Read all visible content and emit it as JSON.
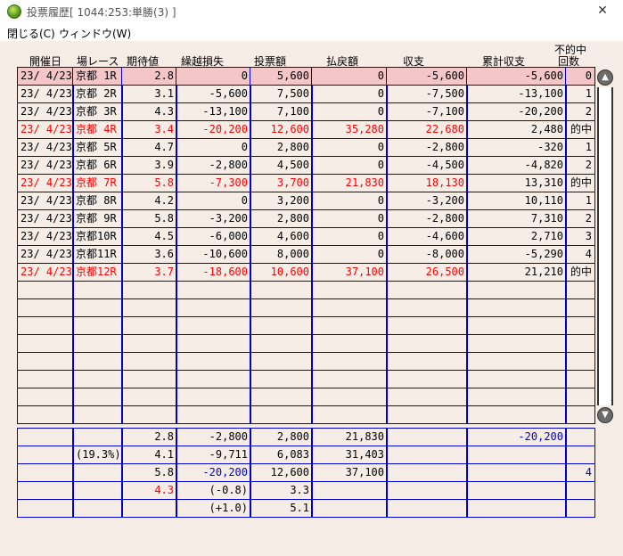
{
  "window": {
    "title": "投票履歴[ 1044:253:単勝(3) ]",
    "close_glyph": "✕"
  },
  "menu": {
    "close": "閉じる(C)",
    "window": "ウィンドウ(W)"
  },
  "headers": {
    "date": "開催日",
    "race": "場レース",
    "expected": "期待値",
    "carryover": "繰越損失",
    "bet": "投票額",
    "payout": "払戻額",
    "balance": "収支",
    "cumulative": "累計収支",
    "miss_line1": "不的中",
    "miss_line2": "回数"
  },
  "rows": [
    {
      "date": "23/ 4/23",
      "race": "京都 1R",
      "exp": "2.8",
      "carry": "0",
      "bet": "5,600",
      "pay": "0",
      "bal": "-5,600",
      "cum": "-5,600",
      "miss": "0",
      "style": "hl"
    },
    {
      "date": "23/ 4/23",
      "race": "京都 2R",
      "exp": "3.1",
      "carry": "-5,600",
      "bet": "7,500",
      "pay": "0",
      "bal": "-7,500",
      "cum": "-13,100",
      "miss": "1",
      "style": ""
    },
    {
      "date": "23/ 4/23",
      "race": "京都 3R",
      "exp": "4.3",
      "carry": "-13,100",
      "bet": "7,100",
      "pay": "0",
      "bal": "-7,100",
      "cum": "-20,200",
      "miss": "2",
      "style": ""
    },
    {
      "date": "23/ 4/23",
      "race": "京都 4R",
      "exp": "3.4",
      "carry": "-20,200",
      "bet": "12,600",
      "pay": "35,280",
      "bal": "22,680",
      "cum": "2,480",
      "miss": "的中",
      "style": "hit"
    },
    {
      "date": "23/ 4/23",
      "race": "京都 5R",
      "exp": "4.7",
      "carry": "0",
      "bet": "2,800",
      "pay": "0",
      "bal": "-2,800",
      "cum": "-320",
      "miss": "1",
      "style": ""
    },
    {
      "date": "23/ 4/23",
      "race": "京都 6R",
      "exp": "3.9",
      "carry": "-2,800",
      "bet": "4,500",
      "pay": "0",
      "bal": "-4,500",
      "cum": "-4,820",
      "miss": "2",
      "style": ""
    },
    {
      "date": "23/ 4/23",
      "race": "京都 7R",
      "exp": "5.8",
      "carry": "-7,300",
      "bet": "3,700",
      "pay": "21,830",
      "bal": "18,130",
      "cum": "13,310",
      "miss": "的中",
      "style": "hit"
    },
    {
      "date": "23/ 4/23",
      "race": "京都 8R",
      "exp": "4.2",
      "carry": "0",
      "bet": "3,200",
      "pay": "0",
      "bal": "-3,200",
      "cum": "10,110",
      "miss": "1",
      "style": ""
    },
    {
      "date": "23/ 4/23",
      "race": "京都 9R",
      "exp": "5.8",
      "carry": "-3,200",
      "bet": "2,800",
      "pay": "0",
      "bal": "-2,800",
      "cum": "7,310",
      "miss": "2",
      "style": ""
    },
    {
      "date": "23/ 4/23",
      "race": "京都10R",
      "exp": "4.5",
      "carry": "-6,000",
      "bet": "4,600",
      "pay": "0",
      "bal": "-4,600",
      "cum": "2,710",
      "miss": "3",
      "style": ""
    },
    {
      "date": "23/ 4/23",
      "race": "京都11R",
      "exp": "3.6",
      "carry": "-10,600",
      "bet": "8,000",
      "pay": "0",
      "bal": "-8,000",
      "cum": "-5,290",
      "miss": "4",
      "style": ""
    },
    {
      "date": "23/ 4/23",
      "race": "京都12R",
      "exp": "3.7",
      "carry": "-18,600",
      "bet": "10,600",
      "pay": "37,100",
      "bal": "26,500",
      "cum": "21,210",
      "miss": "的中",
      "style": "hit"
    }
  ],
  "empty_rows": 8,
  "footer": [
    {
      "race": "",
      "exp": "2.8",
      "carry": "-2,800",
      "bet": "2,800",
      "pay": "21,830",
      "cum": "-20,200",
      "miss": ""
    },
    {
      "race": "(19.3%)",
      "exp": "4.1",
      "carry": "-9,711",
      "bet": "6,083",
      "pay": "31,403",
      "cum": "",
      "miss": ""
    },
    {
      "race": "",
      "exp": "5.8",
      "carry": "-20,200",
      "bet": "12,600",
      "pay": "37,100",
      "cum": "",
      "miss": "4"
    },
    {
      "race": "",
      "exp": "4.3",
      "carry": "(-0.8)",
      "bet": "3.3",
      "pay": "",
      "cum": "",
      "miss": ""
    },
    {
      "race": "",
      "exp": "",
      "carry": "(+1.0)",
      "bet": "5.1",
      "pay": "",
      "cum": "",
      "miss": ""
    }
  ],
  "scroll": {
    "up_glyph": "▲",
    "down_glyph": "▼"
  },
  "colors": {
    "grid": "#0000cc",
    "highlight": "#f5c6c8",
    "hit_text": "#ff0000",
    "background": "#f6ede7"
  }
}
